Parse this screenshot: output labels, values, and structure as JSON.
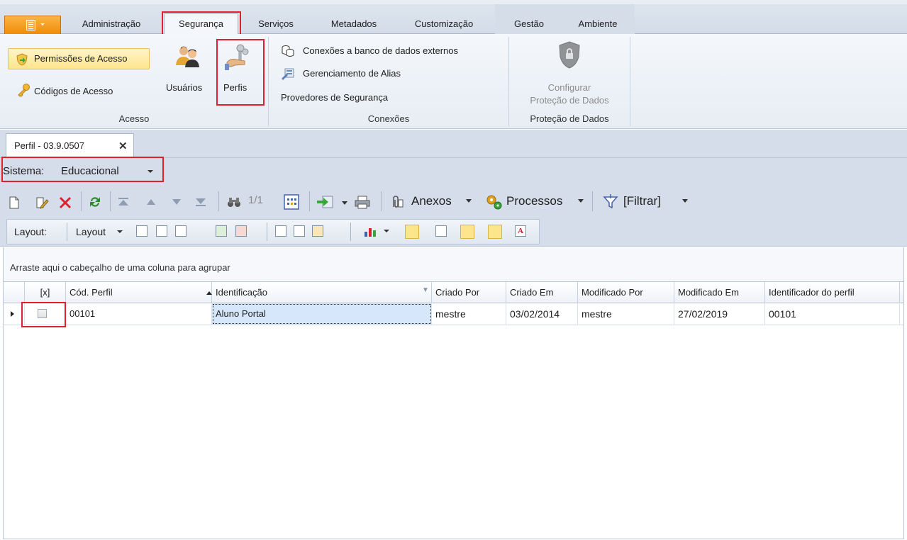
{
  "ribbon_tabs": [
    {
      "label": "Administração"
    },
    {
      "label": "Segurança"
    },
    {
      "label": "Serviços"
    },
    {
      "label": "Metadados"
    },
    {
      "label": "Customização"
    },
    {
      "label": "Gestão"
    },
    {
      "label": "Ambiente"
    }
  ],
  "groups": {
    "acesso": {
      "label": "Acesso",
      "permissoes": "Permissões de Acesso",
      "codigos": "Códigos de Acesso",
      "usuarios": "Usuários",
      "perfis": "Perfis"
    },
    "conexoes": {
      "label": "Conexões",
      "externos": "Conexões a banco de dados externos",
      "alias": "Gerenciamento de Alias",
      "provedores": "Provedores de Segurança"
    },
    "protecao": {
      "label": "Proteção de Dados",
      "configurar_line1": "Configurar",
      "configurar_line2": "Proteção de Dados"
    }
  },
  "document_tab": {
    "title": "Perfil - 03.9.0507",
    "close_glyph": "✕"
  },
  "sistema": {
    "label": "Sistema:",
    "value": "Educacional"
  },
  "toolbar": {
    "record_counter": "1/1",
    "anexos": "Anexos",
    "processos": "Processos",
    "filtrar": "[Filtrar]"
  },
  "layout_bar": {
    "label": "Layout:",
    "dropdown": "Layout"
  },
  "grid": {
    "group_hint": "Arraste aqui o cabeçalho de uma coluna para agrupar",
    "columns": [
      "[x]",
      "Cód. Perfil",
      "Identificação",
      "Criado Por",
      "Criado Em",
      "Modificado Por",
      "Modificado Em",
      "Identificador do perfil"
    ],
    "rows": [
      [
        "",
        "00101",
        "Aluno Portal",
        "mestre",
        "03/02/2014",
        "mestre",
        "27/02/2019",
        "00101"
      ]
    ]
  },
  "colors": {
    "accent_orange": "#f08a06",
    "highlight_red": "#e0202f",
    "ribbon_bg": "#f4f7fb"
  }
}
